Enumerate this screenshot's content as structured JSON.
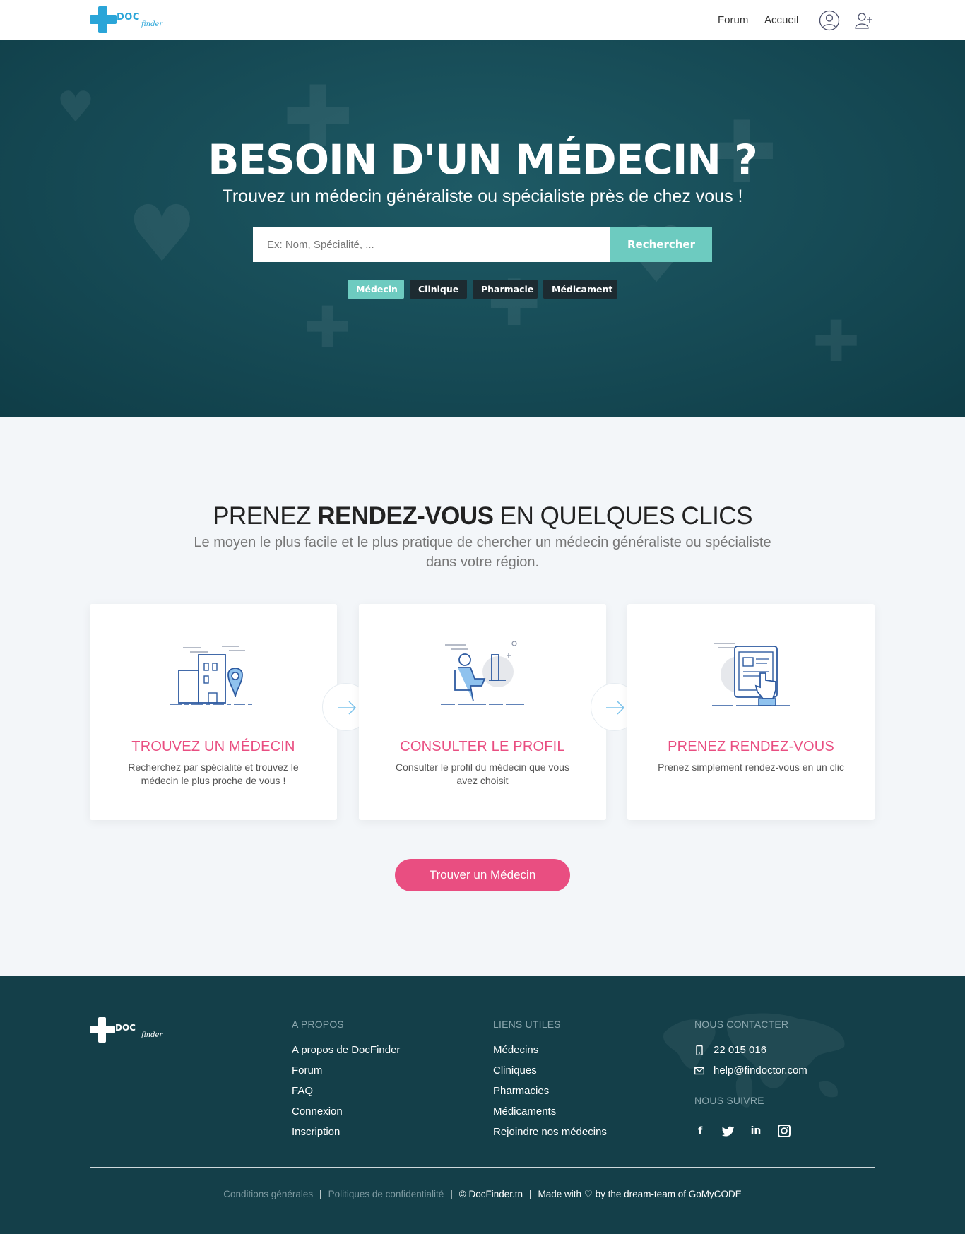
{
  "brand": {
    "logo_text": "DOC",
    "logo_sub": "finder"
  },
  "nav": {
    "links": [
      "Forum",
      "Accueil"
    ],
    "icons": [
      "user-icon",
      "add-user-icon"
    ]
  },
  "hero": {
    "title": "BESOIN D'UN MÉDECIN ?",
    "subtitle": "Trouvez un médecin généraliste ou spécialiste près de chez vous !",
    "search_placeholder": "Ex: Nom, Spécialité, ...",
    "search_button": "Rechercher",
    "filters": [
      {
        "label": "Médecin",
        "active": true
      },
      {
        "label": "Clinique",
        "active": false
      },
      {
        "label": "Pharmacie",
        "active": false
      },
      {
        "label": "Médicament",
        "active": false
      }
    ]
  },
  "steps": {
    "title_pre": "PRENEZ ",
    "title_bold": "RENDEZ-VOUS",
    "title_post": " EN QUELQUES CLICS",
    "description": "Le moyen le plus facile et le plus pratique de chercher un médecin généraliste ou spécialiste dans votre région.",
    "cards": [
      {
        "title": "TROUVEZ UN MÉDECIN",
        "text": "Recherchez par spécialité et trouvez le médecin le plus proche de vous !",
        "illustration": "city-location-pin-icon"
      },
      {
        "title": "CONSULTER LE PROFIL",
        "text": "Consulter le profil du médecin que vous avez choisit",
        "illustration": "person-at-computer-icon"
      },
      {
        "title": "PRENEZ RENDEZ-VOUS",
        "text": "Prenez simplement rendez-vous en un clic",
        "illustration": "tablet-touch-icon"
      }
    ],
    "cta": "Trouver un Médecin"
  },
  "footer": {
    "about": {
      "heading": "A PROPOS",
      "links": [
        "A propos de DocFinder",
        "Forum",
        "FAQ",
        "Connexion",
        "Inscription"
      ]
    },
    "useful": {
      "heading": "LIENS UTILES",
      "links": [
        "Médecins",
        "Cliniques",
        "Pharmacies",
        "Médicaments",
        "Rejoindre nos médecins"
      ]
    },
    "contact": {
      "heading": "NOUS CONTACTER",
      "phone": "22 015 016",
      "email": "help@findoctor.com"
    },
    "follow": {
      "heading": "NOUS SUIVRE",
      "networks": [
        "facebook-icon",
        "twitter-icon",
        "linkedin-icon",
        "instagram-icon"
      ]
    },
    "bottom": {
      "terms": "Conditions générales",
      "privacy": "Politiques de confidentialité",
      "copyright": "© DocFinder.tn",
      "made_with": "Made with ♡ by the dream-team of GoMyCODE"
    }
  },
  "colors": {
    "accent_teal": "#6dcbc0",
    "accent_pink": "#e94e81",
    "hero_bg": "#164a55",
    "footer_bg": "#143f49",
    "logo_blue": "#2aa5d8"
  }
}
